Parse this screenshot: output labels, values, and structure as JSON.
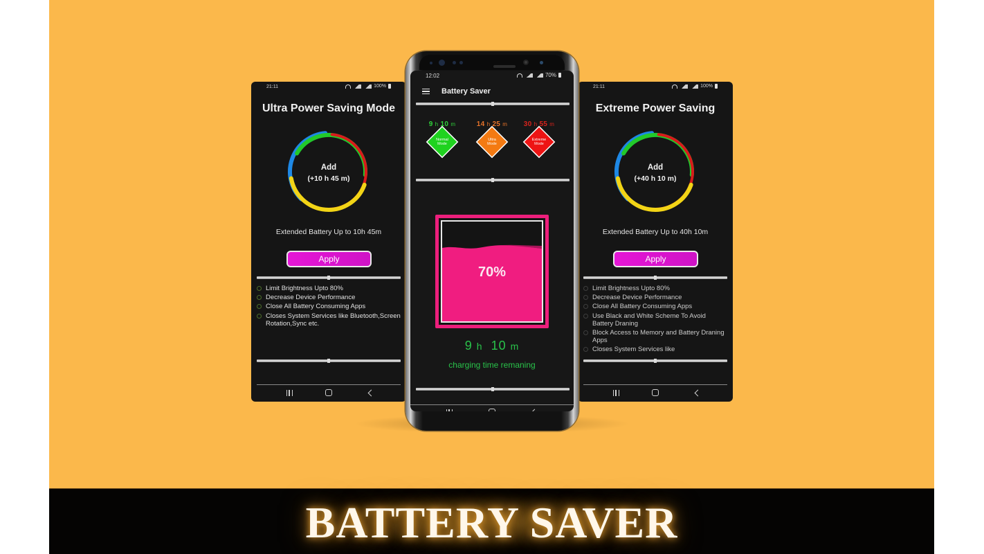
{
  "banner": {
    "title": "BATTERY SAVER"
  },
  "colors": {
    "background": "#fbb84b",
    "normal_mode": "#1fd31f",
    "ultra_mode": "#f47a12",
    "extreme_mode": "#ee1414",
    "battery_fill": "#f01d80",
    "apply_button": "#e516d6",
    "remaining_text": "#29c34a",
    "ring_colors": [
      "#1e88e5",
      "#22c92b",
      "#d81b1b",
      "#f2d416"
    ]
  },
  "left_phone": {
    "status": {
      "time": "21:11",
      "battery": "100%",
      "icons": [
        "wifi-icon",
        "signal-icon",
        "signal-icon",
        "battery-icon"
      ]
    },
    "title": "Ultra Power Saving Mode",
    "ring": {
      "label": "Add",
      "time": "(+10 h 45 m)"
    },
    "extended_text": "Extended Battery Up to 10h 45m",
    "apply_label": "Apply",
    "features": [
      "Limit Brightness Upto 80%",
      "Decrease Device Performance",
      "Close All Battery Consuming Apps",
      "Closes System Services like Bluetooth,Screen Rotation,Sync etc."
    ],
    "nav": [
      "recent-apps-icon",
      "home-icon",
      "back-icon"
    ]
  },
  "center_phone": {
    "status": {
      "time": "12:02",
      "battery": "70%",
      "icons": [
        "wifi-icon",
        "signal-icon",
        "signal-icon",
        "battery-icon"
      ]
    },
    "app_title": "Battery Saver",
    "modes": [
      {
        "hours": "9",
        "h_unit": "h",
        "minutes": "10",
        "m_unit": "m",
        "label_line1": "Normal",
        "label_line2": "Mode"
      },
      {
        "hours": "14",
        "h_unit": "h",
        "minutes": "25",
        "m_unit": "m",
        "label_line1": "Ultra",
        "label_line2": "Mode"
      },
      {
        "hours": "30",
        "h_unit": "h",
        "minutes": "55",
        "m_unit": "m",
        "label_line1": "Extreme",
        "label_line2": "Mode"
      }
    ],
    "battery": {
      "percent_label": "70%",
      "level": 0.7
    },
    "remaining": {
      "hours": "9",
      "h_unit": "h",
      "minutes": "10",
      "m_unit": "m",
      "label": "charging time remaning"
    },
    "nav": [
      "recent-apps-icon",
      "home-icon",
      "back-icon"
    ]
  },
  "right_phone": {
    "status": {
      "time": "21:11",
      "battery": "100%",
      "icons": [
        "wifi-icon",
        "signal-icon",
        "signal-icon",
        "battery-icon"
      ]
    },
    "title": "Extreme Power Saving",
    "ring": {
      "label": "Add",
      "time": "(+40 h 10 m)"
    },
    "extended_text": "Extended Battery Up to 40h 10m",
    "apply_label": "Apply",
    "features": [
      "Limit Brightness Upto 80%",
      "Decrease Device Performance",
      "Close All Battery Consuming Apps",
      "Use Black and White Scheme To Avoid Battery Draning",
      "Block Access to Memory and Battery Draning Apps",
      "Closes System Services like"
    ],
    "nav": [
      "recent-apps-icon",
      "home-icon",
      "back-icon"
    ]
  }
}
